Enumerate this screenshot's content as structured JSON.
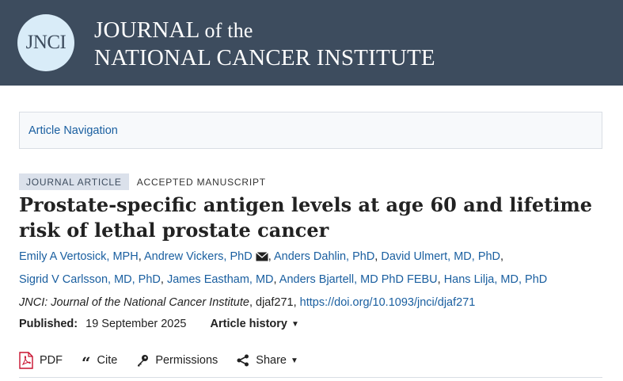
{
  "header": {
    "logo_text": "JNCI",
    "title_line1_main": "JOURNAL",
    "title_line1_suffix": "of the",
    "title_line2": "NATIONAL CANCER INSTITUTE"
  },
  "article_nav": {
    "label": "Article Navigation"
  },
  "badges": {
    "type": "JOURNAL ARTICLE",
    "status": "ACCEPTED MANUSCRIPT"
  },
  "article": {
    "title": "Prostate-specific antigen levels at age 60 and lifetime risk of lethal prostate cancer"
  },
  "authors": [
    "Emily A Vertosick, MPH",
    "Andrew Vickers, PhD",
    "Anders Dahlin, PhD",
    "David Ulmert, MD, PhD",
    "Sigrid V Carlsson, MD, PhD",
    "James Eastham, MD",
    "Anders Bjartell, MD PhD FEBU",
    "Hans Lilja, MD, PhD"
  ],
  "citation": {
    "journal": "JNCI: Journal of the National Cancer Institute",
    "article_id": "djaf271",
    "doi": "https://doi.org/10.1093/jnci/djaf271"
  },
  "published": {
    "label": "Published:",
    "date": "19 September 2025",
    "history_label": "Article history"
  },
  "toolbar": {
    "pdf": "PDF",
    "cite": "Cite",
    "permissions": "Permissions",
    "share": "Share"
  },
  "colors": {
    "header_bg": "#3d4c5e",
    "link": "#1a5fa0",
    "pdf_red": "#c8102e"
  }
}
